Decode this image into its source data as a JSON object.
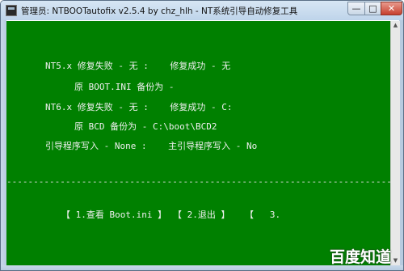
{
  "window": {
    "title": "管理员: NTBOOTautofix v2.5.4 by chz_hlh - NT系统引导自动修复工具",
    "controls": {
      "minimize": "—",
      "maximize": "□",
      "close": "✕"
    }
  },
  "console": {
    "nt5_line": "NT5.x 修复失败 - 无 :    修复成功 - 无",
    "nt5_backup_line": "原 BOOT.INI 备份为 -",
    "nt6_line": "NT6.x 修复失败 - 无 :    修复成功 - C:",
    "nt6_backup_line": "原 BCD 备份为 - C:\\boot\\BCD2",
    "boot_write_line": "引导程序写入 - None :    主引导程序写入 - No",
    "separator": "-------------------------------------------------------------------------------",
    "menu": {
      "item1": "【 1.查看 Boot.ini 】",
      "item2": "【 2.退出 】",
      "item3": "【   3.  "
    }
  },
  "watermark": "百度知道"
}
